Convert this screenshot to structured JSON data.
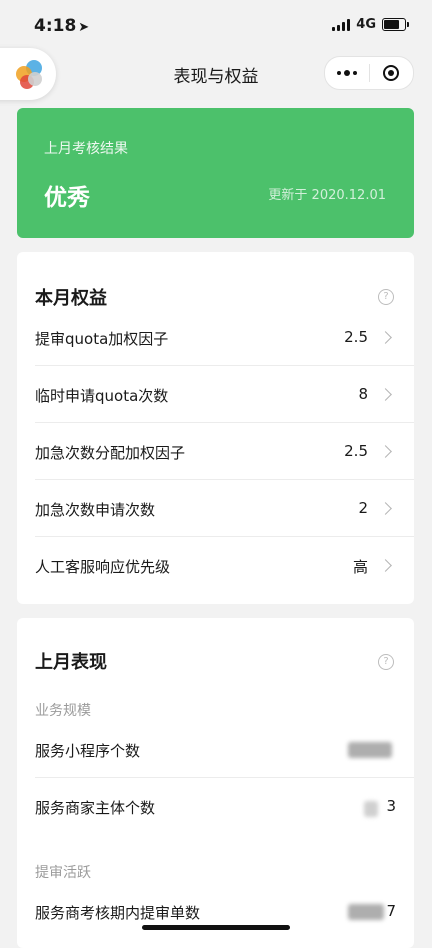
{
  "status_bar": {
    "time": "4:18",
    "network": "4G"
  },
  "nav": {
    "title": "表现与权益"
  },
  "result": {
    "label": "上月考核结果",
    "value": "优秀",
    "updated": "更新于 2020.12.01"
  },
  "benefits": {
    "title": "本月权益",
    "items": [
      {
        "label": "提审quota加权因子",
        "value": "2.5"
      },
      {
        "label": "临时申请quota次数",
        "value": "8"
      },
      {
        "label": "加急次数分配加权因子",
        "value": "2.5"
      },
      {
        "label": "加急次数申请次数",
        "value": "2"
      },
      {
        "label": "人工客服响应优先级",
        "value": "高"
      }
    ]
  },
  "performance": {
    "title": "上月表现",
    "business_scale": {
      "label": "业务规模",
      "items": [
        {
          "label": "服务小程序个数"
        },
        {
          "label": "服务商家主体个数",
          "value_tail": "3"
        }
      ]
    },
    "review_activity": {
      "label": "提审活跃",
      "items": [
        {
          "label": "服务商考核期内提审单数",
          "value_tail": "7"
        }
      ]
    }
  },
  "colors": {
    "accent_green": "#4cc16b",
    "background": "#f2f2f2"
  },
  "icons": [
    "location-arrow-icon",
    "signal-icon",
    "battery-icon",
    "app-logo-icon",
    "more-dots-icon",
    "close-target-icon",
    "help-icon",
    "chevron-right-icon"
  ]
}
